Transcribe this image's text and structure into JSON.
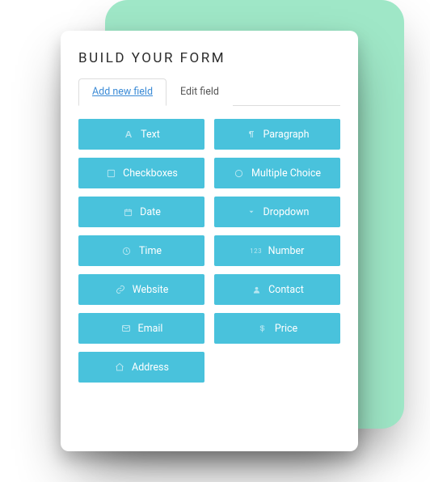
{
  "title": "BUILD YOUR FORM",
  "tabs": {
    "add": "Add new field",
    "edit": "Edit field"
  },
  "fields": {
    "text": "Text",
    "paragraph": "Paragraph",
    "checkboxes": "Checkboxes",
    "multiple_choice": "Multiple Choice",
    "date": "Date",
    "dropdown": "Dropdown",
    "time": "Time",
    "number": "Number",
    "website": "Website",
    "contact": "Contact",
    "email": "Email",
    "price": "Price",
    "address": "Address"
  },
  "colors": {
    "accent_green": "#9fe7c7",
    "button_teal": "#49c2dc",
    "link_blue": "#3b8bd6"
  }
}
